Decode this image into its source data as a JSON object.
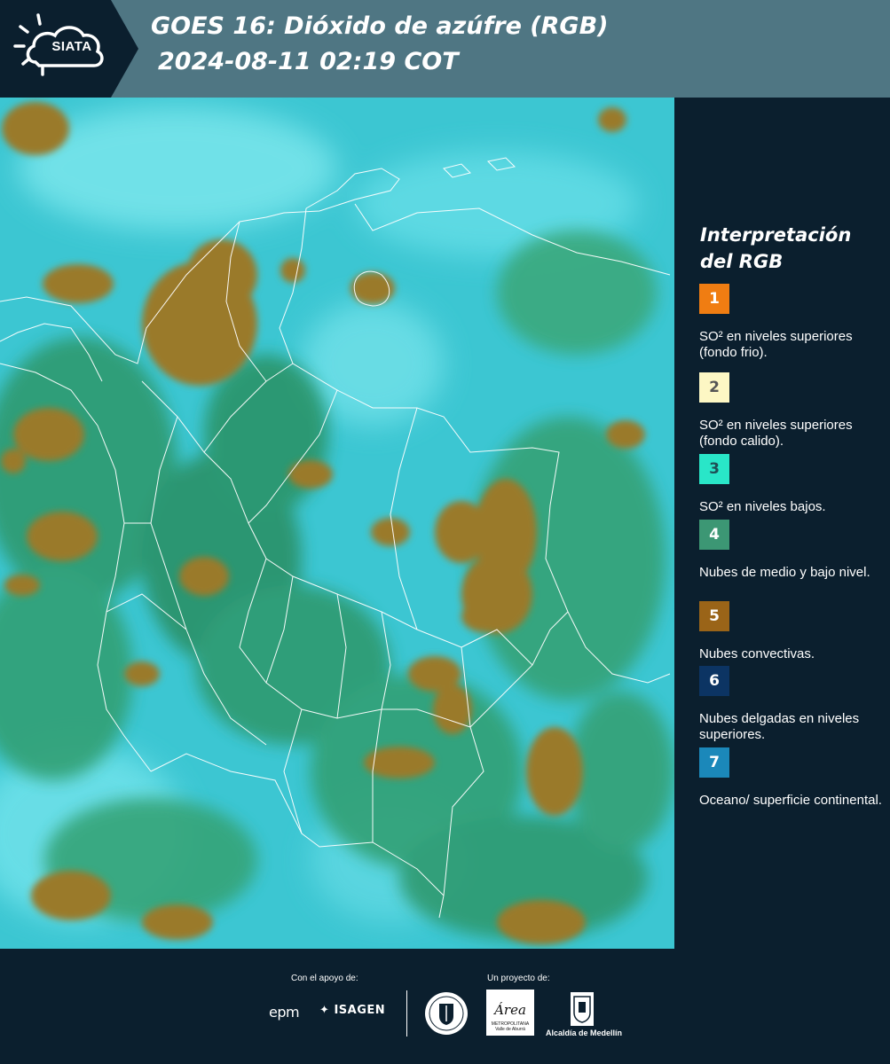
{
  "header": {
    "logo_text": "SIATA",
    "title_line1": "GOES 16: Dióxido de azúfre (RGB)",
    "title_line2": "2024-08-11 02:19 COT",
    "background_color": "#4f7683"
  },
  "legend": {
    "title": "Interpretación del RGB",
    "items": [
      {
        "number": "1",
        "color": "#f07d12",
        "text_color": "#ffffff",
        "description": "SO² en niveles superiores (fondo frio)."
      },
      {
        "number": "2",
        "color": "#fdf7c4",
        "text_color": "#555555",
        "description": "SO² en niveles superiores (fondo calido)."
      },
      {
        "number": "3",
        "color": "#29e6c8",
        "text_color": "#1f4f55",
        "description": "SO² en niveles bajos."
      },
      {
        "number": "4",
        "color": "#3c9774",
        "text_color": "#ffffff",
        "description": "Nubes de medio y bajo nivel."
      },
      {
        "number": "5",
        "color": "#9a6418",
        "text_color": "#ffffff",
        "description": "Nubes convectivas."
      },
      {
        "number": "6",
        "color": "#0c3463",
        "text_color": "#ffffff",
        "description": "Nubes delgadas en niveles superiores."
      },
      {
        "number": "7",
        "color": "#1b88ba",
        "text_color": "#ffffff",
        "description": "Oceano/ superficie continental."
      }
    ]
  },
  "footer": {
    "support_label": "Con el apoyo de:",
    "project_label": "Un proyecto de:",
    "sponsor_epm": "epm",
    "sponsor_isagen": "ISAGEN",
    "area_logo_text": "Área",
    "area_logo_subtitle": "METROPOLITANA Valle de Aburrá",
    "alcaldia_label": "Alcaldía de Medellín"
  },
  "map": {
    "base_color": "#3cc3cf",
    "convective_color": "#9a7a2c",
    "vegetation_color": "#2e9a6e",
    "border_color": "#ffffff"
  }
}
